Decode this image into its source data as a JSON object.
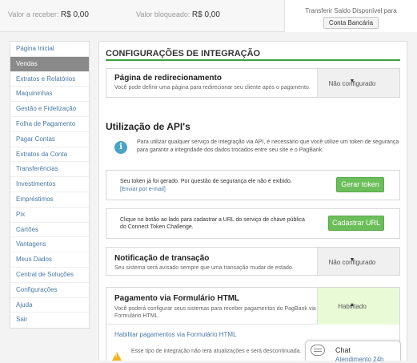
{
  "top": {
    "receive_label": "Valor a receber:",
    "receive_value": "R$ 0,00",
    "blocked_label": "Valor bloqueado:",
    "blocked_value": "R$ 0,00",
    "transfer_text": "Transferir Saldo Disponível para",
    "transfer_button": "Conta Bancária"
  },
  "sidebar": {
    "items": [
      {
        "label": "Página Inicial"
      },
      {
        "label": "Vendas"
      },
      {
        "label": "Extratos e Relatórios"
      },
      {
        "label": "Maquininhas"
      },
      {
        "label": "Gestão e Fidelização"
      },
      {
        "label": "Folha de Pagamento"
      },
      {
        "label": "Pagar Contas"
      },
      {
        "label": "Extratos da Conta"
      },
      {
        "label": "Transferências"
      },
      {
        "label": "Investimentos"
      },
      {
        "label": "Empréstimos"
      },
      {
        "label": "Pix"
      },
      {
        "label": "Cartões"
      },
      {
        "label": "Vantagens"
      },
      {
        "label": "Meus Dados"
      },
      {
        "label": "Central de Soluções"
      },
      {
        "label": "Configurações"
      },
      {
        "label": "Ajuda"
      },
      {
        "label": "Sair"
      }
    ],
    "active_index": 1
  },
  "main": {
    "title": "CONFIGURAÇÕES DE INTEGRAÇÃO",
    "redirect": {
      "title": "Página de redirecionamento",
      "desc": "Você pode definir uma página para redirecionar seu cliente após o pagamento.",
      "status": "Não configurado"
    },
    "api_title": "Utilização de API's",
    "api_info": "Para utilizar qualquer serviço de integração via API, é necessário que você utilize um token de segurança para garantir a integridade dos dados trocados entre seu site e o PagBank.",
    "token": {
      "text": "Seu token já foi gerado. Por questão de segurança ele não é exibido.",
      "link": "[Enviar por e-mail]",
      "button": "Gerar token"
    },
    "connect": {
      "text1": "Clique no botão ao lado para cadastrar a URL do serviço de chave pública",
      "text2": "do Connect Token Challenge.",
      "button": "Cadastrar URL"
    },
    "notify": {
      "title": "Notificação de transação",
      "desc": "Seu sistema será avisado sempre que uma transação mudar de estado.",
      "status": "Não configurado"
    },
    "form": {
      "title": "Pagamento via Formulário HTML",
      "desc1": "Você poderá configurar seus sistemas para receber pagamentos do PagBank via",
      "desc2": "Formulário HTML.",
      "status": "Habilitado",
      "enable_prefix": "Habilitar pagamentos via",
      "enable_link": "Formulário HTML",
      "warning": "Esse tipo de integração não terá atualizações e será descontinuada."
    }
  },
  "chat": {
    "title": "Chat",
    "subtitle": "Atendimento 24h"
  },
  "colors": {
    "accent_green": "#3aa23a",
    "button_green": "#6cbe5a",
    "link_blue": "#4a7aa6",
    "info_blue": "#4aa3c7",
    "enabled_bg": "#e9fbd6"
  },
  "icons": [
    "info-icon",
    "caret-down-icon",
    "caret-up-icon",
    "warning-icon",
    "chat-bubble-icon"
  ]
}
